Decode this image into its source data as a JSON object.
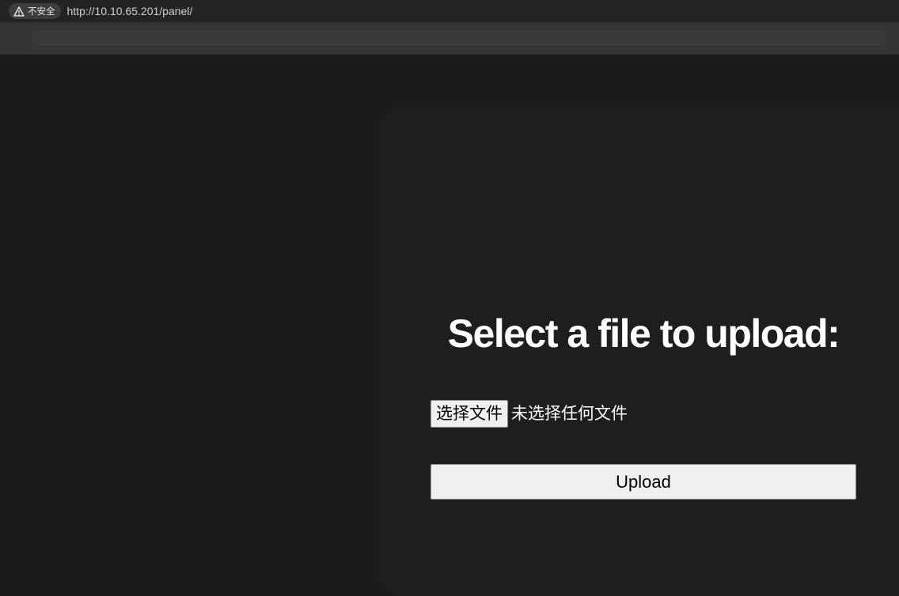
{
  "browser": {
    "security_label": "不安全",
    "url": "http://10.10.65.201/panel/"
  },
  "upload_form": {
    "title": "Select a file to upload:",
    "choose_file_label": "选择文件",
    "no_file_text": "未选择任何文件",
    "upload_label": "Upload"
  },
  "icons": {
    "security_warning": "warning-triangle-icon"
  },
  "colors": {
    "page_background": "#1b1b1b",
    "card_background": "#1e1e1e",
    "button_background": "#efefef",
    "text_primary": "#ffffff"
  }
}
